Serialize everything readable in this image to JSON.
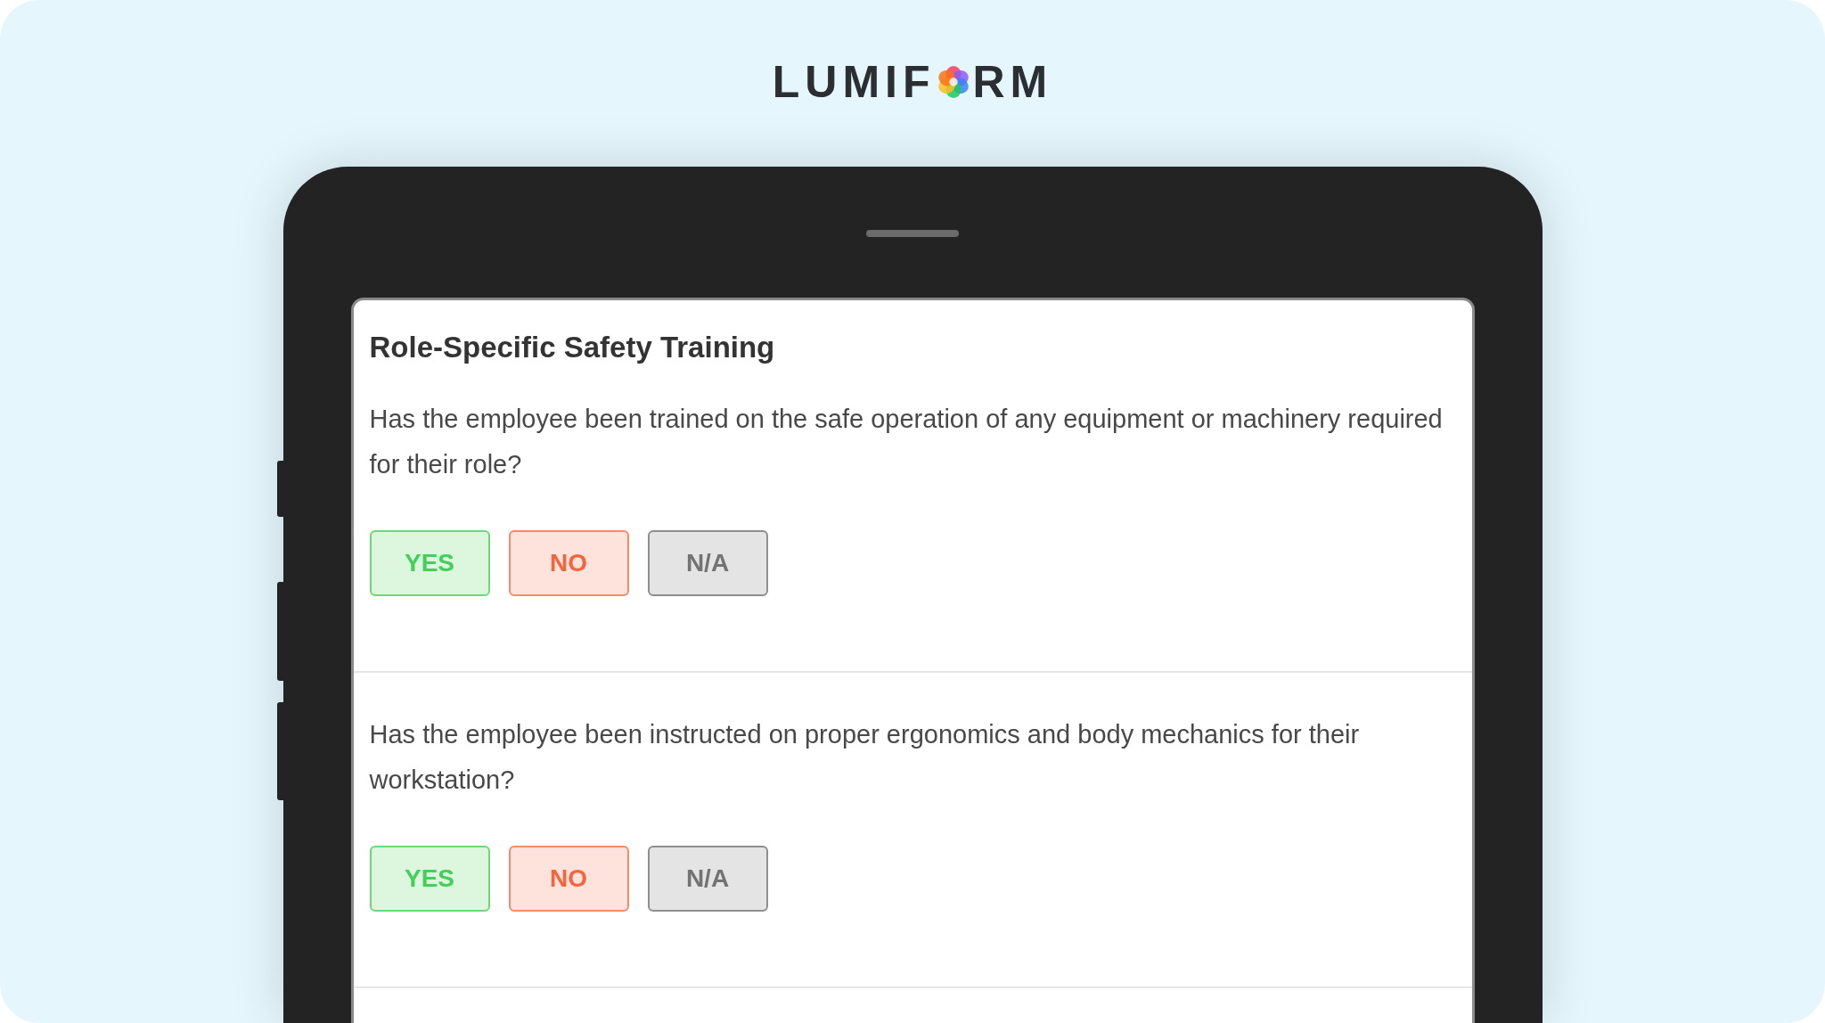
{
  "logo": {
    "before": "LUMIF",
    "after": "RM"
  },
  "form": {
    "title": "Role-Specific Safety Training",
    "questions": [
      {
        "text": "Has the employee been trained on the safe operation of any equipment or machinery required for their role?",
        "answers": [
          {
            "label": "YES",
            "kind": "yes"
          },
          {
            "label": "NO",
            "kind": "no"
          },
          {
            "label": "N/A",
            "kind": "na"
          }
        ]
      },
      {
        "text": "Has the employee been instructed on proper ergonomics and body mechanics for their workstation?",
        "answers": [
          {
            "label": "YES",
            "kind": "yes"
          },
          {
            "label": "NO",
            "kind": "no"
          },
          {
            "label": "N/A",
            "kind": "na"
          }
        ]
      }
    ]
  }
}
